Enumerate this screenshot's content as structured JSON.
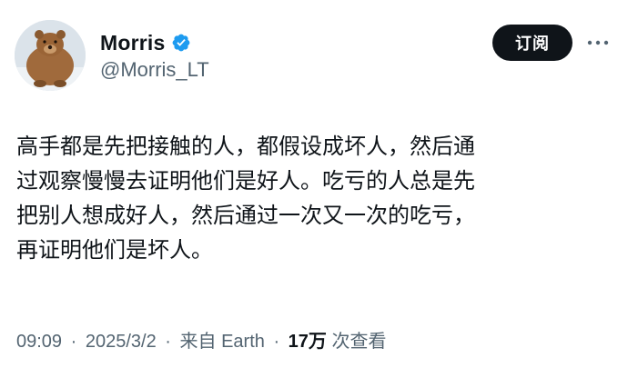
{
  "user": {
    "display_name": "Morris",
    "handle": "@Morris_LT",
    "verified": true,
    "avatar": "bear-avatar"
  },
  "actions": {
    "subscribe_label": "订阅",
    "more_icon": "more-horizontal-icon"
  },
  "tweet": {
    "lines": [
      "高手都是先把接触的人，都假设成坏人，然后通",
      "过观察慢慢去证明他们是好人。吃亏的人总是先",
      "把别人想成好人，然后通过一次又一次的吃亏，",
      "再证明他们是坏人。"
    ]
  },
  "meta": {
    "time": "09:09",
    "separator": "·",
    "date": "2025/3/2",
    "source": "来自 Earth",
    "views_count": "17万",
    "views_label": "次查看"
  },
  "colors": {
    "primary_text": "#0f1419",
    "secondary_text": "#536471",
    "verified_blue": "#1d9bf0",
    "button_bg": "#0f1419"
  }
}
